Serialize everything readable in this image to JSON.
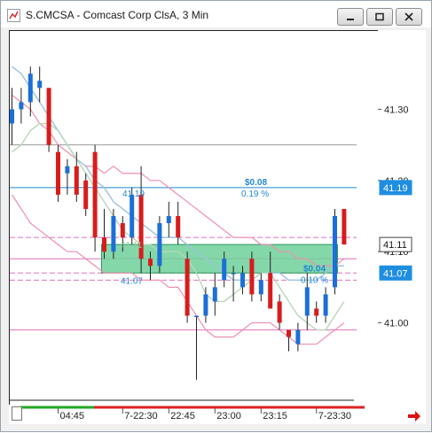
{
  "window": {
    "title": "S.CMCSA - Comcast Corp ClsA, 3 Min"
  },
  "colors": {
    "up": "#1c6fd8",
    "down": "#d81c1c",
    "bb_upper": "#f08fb0",
    "ma_fast": "#9cc3e0",
    "ma_slow": "#b8d8b8",
    "level_line": "#e070c0",
    "measure_text": "#1f88d6",
    "rect_fill": "#6fd09a",
    "rect_border": "#2a9a5a",
    "price_tag_blue": "#1e8ee0",
    "price_tag_white": "#ffffff"
  },
  "chart_data": {
    "type": "candlestick",
    "title": "S.CMCSA - Comcast Corp ClsA, 3 Min",
    "ylim": [
      40.885,
      41.41
    ],
    "price_ticks": [
      "41.30",
      "41.20",
      "41.10",
      "41.00"
    ],
    "price_tick_values": [
      41.3,
      41.2,
      41.1,
      41.0
    ],
    "time_labels": [
      "04:45",
      "7-22:30",
      "22:45",
      "23:00",
      "23:15",
      "7-23:30"
    ],
    "time_label_bar_index": [
      5,
      12,
      17,
      22,
      27,
      33
    ],
    "last_price_tag": "41.11",
    "price_tags_blue": [
      "41.19",
      "41.07"
    ],
    "candles": [
      {
        "o": 41.28,
        "h": 41.33,
        "l": 41.25,
        "c": 41.3
      },
      {
        "o": 41.3,
        "h": 41.33,
        "l": 41.28,
        "c": 41.31
      },
      {
        "o": 41.31,
        "h": 41.36,
        "l": 41.29,
        "c": 41.35
      },
      {
        "o": 41.33,
        "h": 41.36,
        "l": 41.31,
        "c": 41.34
      },
      {
        "o": 41.33,
        "h": 41.33,
        "l": 41.24,
        "c": 41.25
      },
      {
        "o": 41.24,
        "h": 41.25,
        "l": 41.17,
        "c": 41.18
      },
      {
        "o": 41.21,
        "h": 41.23,
        "l": 41.18,
        "c": 41.22
      },
      {
        "o": 41.22,
        "h": 41.24,
        "l": 41.17,
        "c": 41.18
      },
      {
        "o": 41.2,
        "h": 41.21,
        "l": 41.15,
        "c": 41.16
      },
      {
        "o": 41.24,
        "h": 41.25,
        "l": 41.1,
        "c": 41.12
      },
      {
        "o": 41.12,
        "h": 41.16,
        "l": 41.09,
        "c": 41.1
      },
      {
        "o": 41.1,
        "h": 41.16,
        "l": 41.09,
        "c": 41.15
      },
      {
        "o": 41.14,
        "h": 41.15,
        "l": 41.1,
        "c": 41.12
      },
      {
        "o": 41.12,
        "h": 41.19,
        "l": 41.11,
        "c": 41.18
      },
      {
        "o": 41.18,
        "h": 41.22,
        "l": 41.07,
        "c": 41.09
      },
      {
        "o": 41.09,
        "h": 41.1,
        "l": 41.06,
        "c": 41.08
      },
      {
        "o": 41.08,
        "h": 41.15,
        "l": 41.07,
        "c": 41.14
      },
      {
        "o": 41.14,
        "h": 41.17,
        "l": 41.12,
        "c": 41.15
      },
      {
        "o": 41.15,
        "h": 41.17,
        "l": 41.11,
        "c": 41.12
      },
      {
        "o": 41.09,
        "h": 41.1,
        "l": 41.0,
        "c": 41.01
      },
      {
        "o": 41.01,
        "h": 41.01,
        "l": 40.92,
        "c": 41.01
      },
      {
        "o": 41.01,
        "h": 41.05,
        "l": 41.0,
        "c": 41.04
      },
      {
        "o": 41.03,
        "h": 41.07,
        "l": 41.01,
        "c": 41.05
      },
      {
        "o": 41.06,
        "h": 41.1,
        "l": 41.05,
        "c": 41.09
      },
      {
        "o": 41.07,
        "h": 41.08,
        "l": 41.03,
        "c": 41.07
      },
      {
        "o": 41.05,
        "h": 41.08,
        "l": 41.04,
        "c": 41.07
      },
      {
        "o": 41.09,
        "h": 41.1,
        "l": 41.03,
        "c": 41.04
      },
      {
        "o": 41.04,
        "h": 41.07,
        "l": 41.03,
        "c": 41.06
      },
      {
        "o": 41.07,
        "h": 41.1,
        "l": 41.02,
        "c": 41.02
      },
      {
        "o": 41.03,
        "h": 41.04,
        "l": 40.99,
        "c": 41.0
      },
      {
        "o": 40.99,
        "h": 40.99,
        "l": 40.96,
        "c": 40.98
      },
      {
        "o": 40.97,
        "h": 41.0,
        "l": 40.96,
        "c": 40.99
      },
      {
        "o": 41.01,
        "h": 41.07,
        "l": 40.99,
        "c": 41.05
      },
      {
        "o": 41.02,
        "h": 41.03,
        "l": 41.0,
        "c": 41.01
      },
      {
        "o": 41.01,
        "h": 41.05,
        "l": 41.0,
        "c": 41.04
      },
      {
        "o": 41.05,
        "h": 41.16,
        "l": 41.04,
        "c": 41.15
      },
      {
        "o": 41.16,
        "h": 41.16,
        "l": 41.11,
        "c": 41.11
      }
    ],
    "horizontal_lines": [
      {
        "value": 41.25,
        "color": "#9a9a9a",
        "style": "solid"
      },
      {
        "value": 41.19,
        "color": "#1f88d6",
        "style": "solid"
      },
      {
        "value": 41.12,
        "color": "#e070c0",
        "style": "dashed"
      },
      {
        "value": 41.09,
        "color": "#e070c0",
        "style": "solid"
      },
      {
        "value": 41.07,
        "color": "#e070c0",
        "style": "dashed"
      },
      {
        "value": 41.06,
        "color": "#e070c0",
        "style": "dashed"
      },
      {
        "value": 40.99,
        "color": "#e070c0",
        "style": "solid"
      }
    ],
    "measure_rect": {
      "from": 41.11,
      "to": 41.07,
      "start_bar": 10,
      "end_bar": 35
    },
    "annotations": [
      {
        "text": "$0.08",
        "value": 41.19
      },
      {
        "text": "0.19 %",
        "value": 41.19
      },
      {
        "text": "41.19",
        "value": 41.19
      },
      {
        "text": "41.07",
        "value": 41.07
      },
      {
        "text": "$0.04",
        "value": 41.07
      },
      {
        "text": "0.10 %",
        "value": 41.07
      },
      {
        "text": "41.11",
        "value": 41.11
      }
    ],
    "bb_upper": [
      41.32,
      41.31,
      41.3,
      41.28,
      41.27,
      41.25,
      41.24,
      41.23,
      41.22,
      41.22,
      41.21,
      41.22,
      41.21,
      41.21,
      41.21,
      41.2,
      41.2,
      41.19,
      41.18,
      41.17,
      41.16,
      41.15,
      41.14,
      41.13,
      41.12,
      41.12,
      41.12,
      41.11,
      41.11,
      41.1,
      41.1,
      41.09,
      41.09,
      41.08,
      41.08,
      41.08,
      41.09
    ],
    "bb_lower": [
      41.18,
      41.16,
      41.14,
      41.13,
      41.12,
      41.11,
      41.1,
      41.1,
      41.09,
      41.08,
      41.07,
      41.07,
      41.07,
      41.07,
      41.06,
      41.06,
      41.06,
      41.05,
      41.05,
      41.03,
      41.01,
      40.99,
      40.98,
      40.98,
      40.98,
      40.99,
      41.0,
      41.0,
      41.0,
      40.99,
      40.98,
      40.97,
      40.97,
      40.97,
      40.98,
      40.99,
      41.0
    ],
    "ma_fast": [
      41.36,
      41.35,
      41.33,
      41.31,
      41.29,
      41.27,
      41.25,
      41.23,
      41.22,
      41.2,
      41.19,
      41.17,
      41.16,
      41.15,
      41.14,
      41.13,
      41.12,
      41.12,
      41.12,
      41.11,
      41.1,
      41.09,
      41.08,
      41.07,
      41.06,
      41.06,
      41.06,
      41.07,
      41.07,
      41.07,
      41.06,
      41.06,
      41.06,
      41.06,
      41.07,
      41.08,
      41.08
    ],
    "ma_slow": [
      41.24,
      41.25,
      41.27,
      41.28,
      41.28,
      41.27,
      41.25,
      41.23,
      41.21,
      41.19,
      41.17,
      41.15,
      41.13,
      41.12,
      41.11,
      41.11,
      41.1,
      41.1,
      41.1,
      41.09,
      41.07,
      41.04,
      41.03,
      41.03,
      41.04,
      41.05,
      41.06,
      41.07,
      41.07,
      41.05,
      41.03,
      41.01,
      41.0,
      40.99,
      40.99,
      41.01,
      41.03
    ]
  }
}
